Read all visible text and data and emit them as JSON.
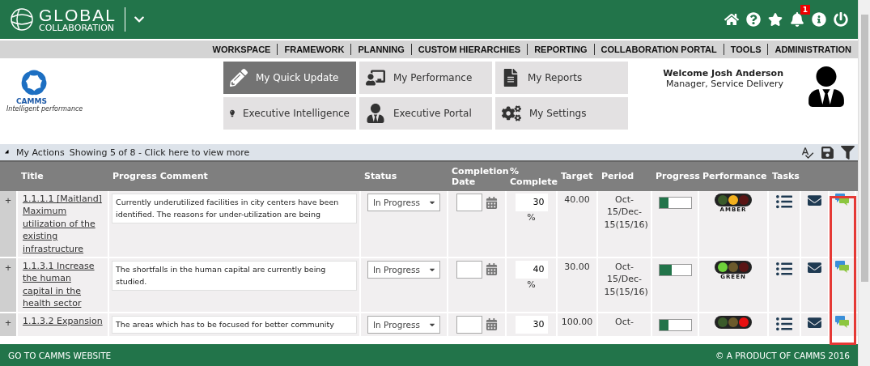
{
  "header": {
    "logo_title": "GLOBAL",
    "logo_subtitle": "COLLABORATION",
    "notification_count": "1"
  },
  "nav": [
    "WORKSPACE",
    "FRAMEWORK",
    "PLANNING",
    "CUSTOM HIERARCHIES",
    "REPORTING",
    "COLLABORATION PORTAL",
    "TOOLS",
    "ADMINISTRATION"
  ],
  "brand": {
    "name": "CAMMS",
    "tagline": "Intelligent performance"
  },
  "tiles": [
    {
      "kind": "pencil",
      "label": "My Quick Update",
      "selected": true
    },
    {
      "kind": "performance",
      "label": "My Performance",
      "selected": false
    },
    {
      "kind": "reports",
      "label": "My Reports",
      "selected": false
    },
    {
      "kind": "bulb",
      "label": "Executive Intelligence",
      "selected": false
    },
    {
      "kind": "portal",
      "label": "Executive Portal",
      "selected": false
    },
    {
      "kind": "settings",
      "label": "My Settings",
      "selected": false
    }
  ],
  "user": {
    "welcome": "Welcome Josh Anderson",
    "role": "Manager, Service Delivery"
  },
  "actions_bar": {
    "title": "My Actions",
    "summary": "Showing 5 of 8 - Click here to view more"
  },
  "table": {
    "columns": [
      "Title",
      "Progress Comment",
      "Status",
      "Completion Date",
      "% Complete",
      "Target",
      "Period",
      "Progress",
      "Performance",
      "Tasks"
    ],
    "rows": [
      {
        "expander": "+",
        "title": "1.1.1.1 [Maitland] Maximum utilization of the existing infrastructure",
        "comment": "Currently underutilized facilities in city centers have been identified. The reasons for under-utilization  are being",
        "status": "In Progress",
        "percent": "30",
        "percent_unit": "%",
        "target": "40.00",
        "period": "Oct-15/Dec-15(15/16)",
        "level": 0.3,
        "color": "#f2b01e",
        "light_label": "AMBER"
      },
      {
        "expander": "+",
        "title": "1.1.3.1 Increase the human capital in the health sector",
        "comment": "The shortfalls in the human capital are currently being studied.",
        "status": "In Progress",
        "percent": "40",
        "percent_unit": "%",
        "target": "30.00",
        "period": "Oct-15/Dec-15(15/16)",
        "level": 0.4,
        "color": "#6ed13a",
        "light_label": "GREEN"
      },
      {
        "expander": "+",
        "title": "1.1.3.2 Expansion",
        "comment": "The areas which has to be focused for better community",
        "status": "In Progress",
        "percent": "30",
        "target": "100.00",
        "period": "Oct-",
        "level": 0.3,
        "color": "#e81010"
      }
    ]
  },
  "footer": {
    "left": "GO TO CAMMS WEBSITE",
    "right": "© A PRODUCT OF CAMMS 2016"
  }
}
